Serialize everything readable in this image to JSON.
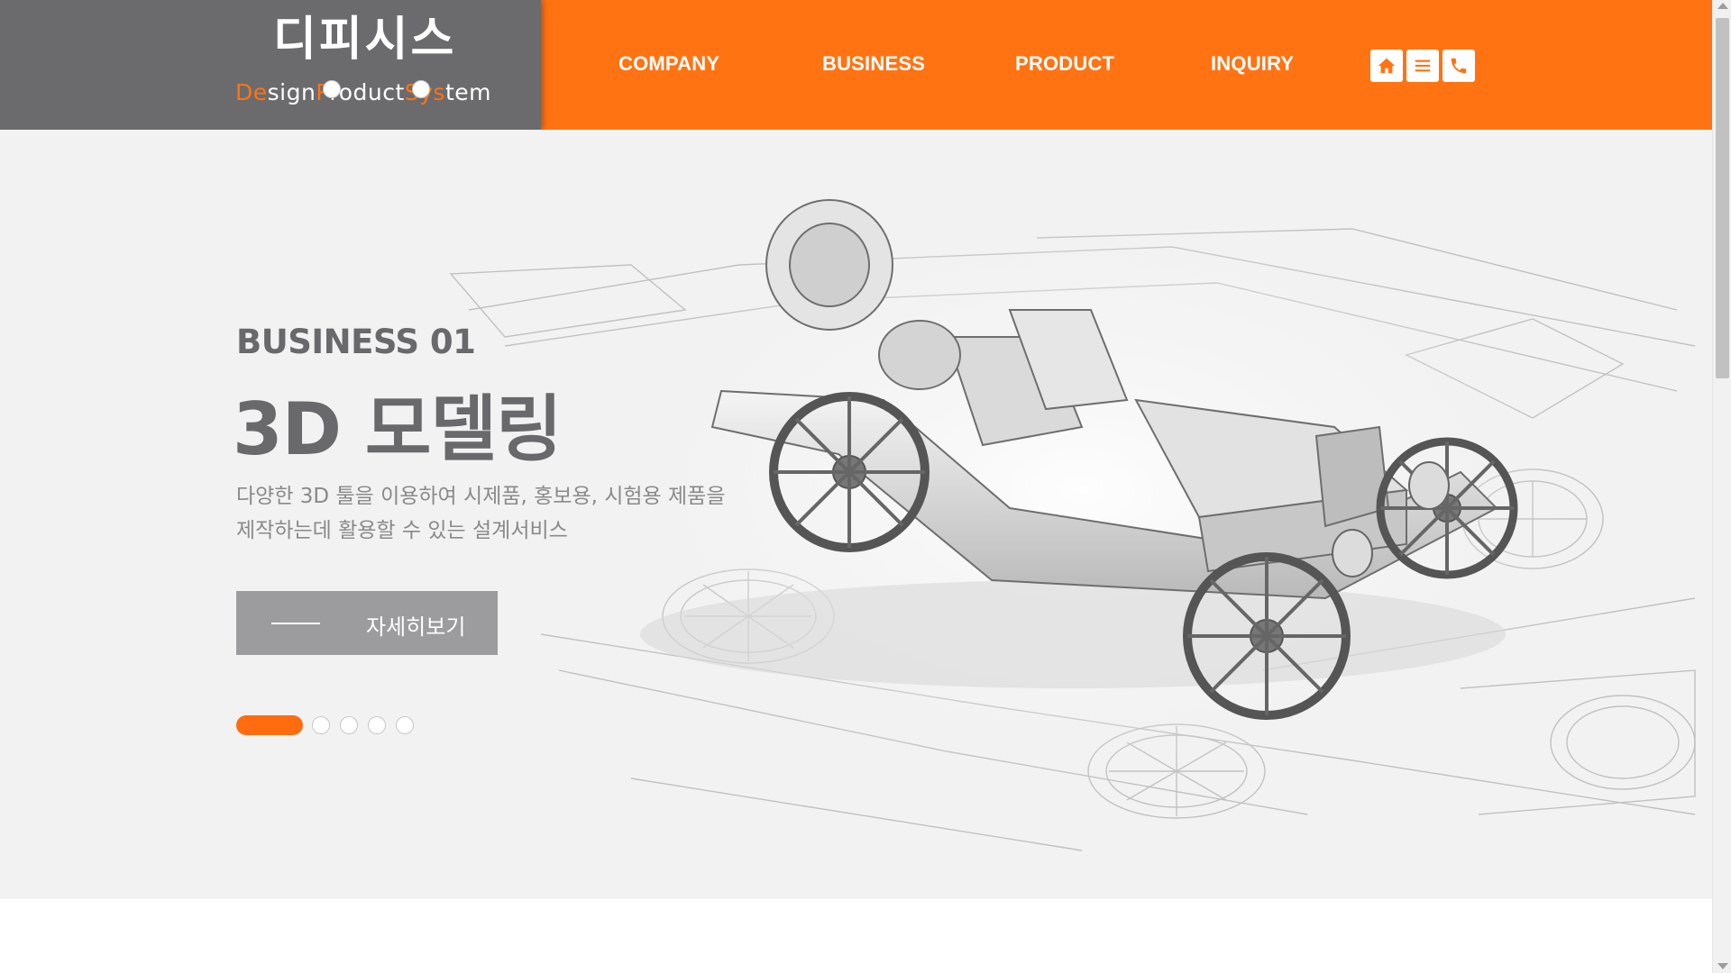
{
  "header": {
    "logo": {
      "title": "디피시스",
      "sub_words": [
        {
          "highlight": "De",
          "rest": "sign"
        },
        {
          "highlight": "P",
          "rest": "roduct"
        },
        {
          "highlight": "Sys",
          "rest": "tem"
        }
      ],
      "separator": "•"
    },
    "nav": [
      "COMPANY",
      "BUSINESS",
      "PRODUCT",
      "INQUIRY"
    ],
    "icons": [
      "home-icon",
      "menu-icon",
      "phone-icon"
    ]
  },
  "hero": {
    "label": "BUSINESS 01",
    "title": "3D 모델링",
    "desc_line1": "다양한 3D 툴을 이용하여 시제품, 홍보용, 시험용 제품을",
    "desc_line2": "제작하는데 활용할 수 있는 설계서비스",
    "button_label": "자세히보기",
    "slides_total": 5,
    "active_slide": 1
  },
  "colors": {
    "accent": "#ff7313",
    "logo_bg": "#6b6b6d",
    "hero_bg": "#f2f2f2",
    "text_gray": "#69686a",
    "button_bg": "#9c9b9d"
  }
}
